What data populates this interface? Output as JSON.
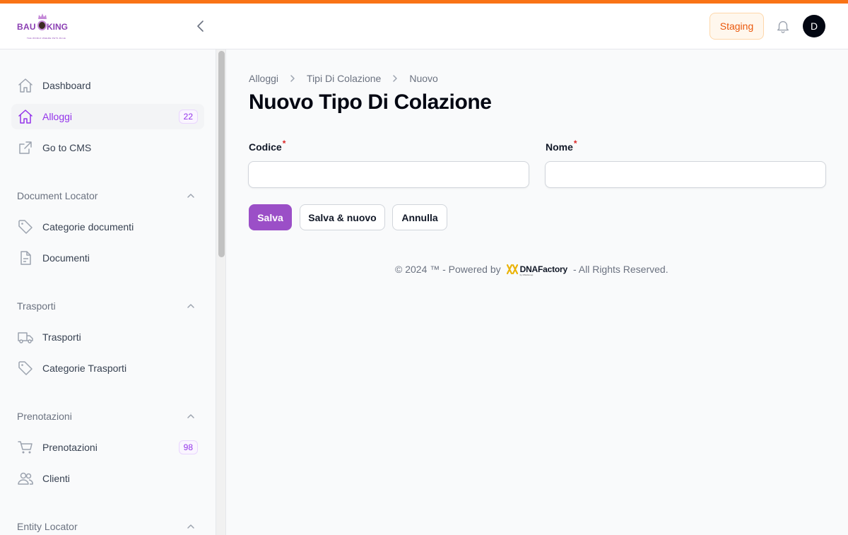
{
  "header": {
    "logo": {
      "text_left": "BAU",
      "text_right": "KING",
      "tagline": "THE WORLD WHERE PETS RULE"
    },
    "env_badge": "Staging",
    "avatar_initial": "D",
    "accent_color": "#f97316"
  },
  "sidebar": {
    "items": [
      {
        "label": "Dashboard",
        "icon": "home-icon"
      },
      {
        "label": "Alloggi",
        "icon": "home-icon",
        "badge": "22",
        "active": true
      },
      {
        "label": "Go to CMS",
        "icon": "external-link-icon"
      }
    ],
    "groups": [
      {
        "title": "Document Locator",
        "items": [
          {
            "label": "Categorie documenti",
            "icon": "tag-icon"
          },
          {
            "label": "Documenti",
            "icon": "document-icon"
          }
        ]
      },
      {
        "title": "Trasporti",
        "items": [
          {
            "label": "Trasporti",
            "icon": "truck-icon"
          },
          {
            "label": "Categorie Trasporti",
            "icon": "tag-icon"
          }
        ]
      },
      {
        "title": "Prenotazioni",
        "items": [
          {
            "label": "Prenotazioni",
            "icon": "cart-icon",
            "badge": "98"
          },
          {
            "label": "Clienti",
            "icon": "users-icon"
          }
        ]
      },
      {
        "title": "Entity Locator",
        "items": []
      }
    ]
  },
  "main": {
    "breadcrumbs": [
      "Alloggi",
      "Tipi Di Colazione",
      "Nuovo"
    ],
    "title": "Nuovo Tipo Di Colazione",
    "fields": [
      {
        "label": "Codice",
        "required_mark": "*",
        "value": "",
        "placeholder": ""
      },
      {
        "label": "Nome",
        "required_mark": "*",
        "value": "",
        "placeholder": ""
      }
    ],
    "buttons": {
      "save": "Salva",
      "save_new": "Salva & nuovo",
      "cancel": "Annulla"
    },
    "primary_color": "#9b4fc7",
    "footer": {
      "prefix": "© 2024 ™ - Powered by",
      "brand": "DNAFactory",
      "brand_sub": "by DNAGroup",
      "suffix": "- All Rights Reserved."
    }
  }
}
